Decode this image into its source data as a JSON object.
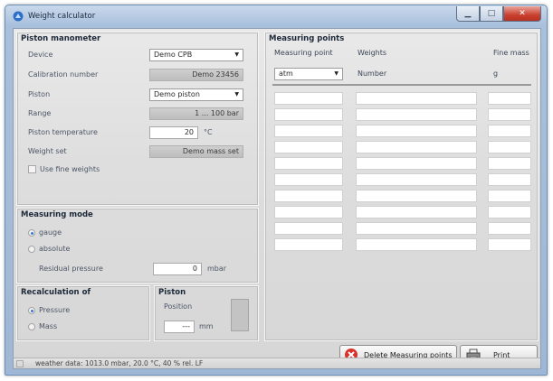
{
  "window": {
    "title": "Weight calculator"
  },
  "piston_manometer": {
    "title": "Piston manometer",
    "device_label": "Device",
    "device_value": "Demo CPB",
    "calibration_label": "Calibration number",
    "calibration_value": "Demo 23456",
    "piston_label": "Piston",
    "piston_value": "Demo piston",
    "range_label": "Range",
    "range_value": "1 ... 100 bar",
    "temp_label": "Piston temperature",
    "temp_value": "20",
    "temp_unit": "°C",
    "weightset_label": "Weight set",
    "weightset_value": "Demo mass set",
    "fine_weights_label": "Use fine weights",
    "fine_weights_checked": false
  },
  "measuring_mode": {
    "title": "Measuring mode",
    "gauge_label": "gauge",
    "absolute_label": "absolute",
    "selected": "gauge",
    "residual_label": "Residual pressure",
    "residual_value": "0",
    "residual_unit": "mbar"
  },
  "recalculation": {
    "title": "Recalculation of",
    "pressure_label": "Pressure",
    "mass_label": "Mass",
    "selected": "Pressure"
  },
  "piston": {
    "title": "Piston",
    "position_label": "Position",
    "position_value": "---",
    "position_unit": "mm"
  },
  "measuring_points": {
    "title": "Measuring points",
    "col_point": "Measuring point",
    "col_weights": "Weights",
    "col_fine": "Fine mass",
    "point_select": "atm",
    "weights_sub": "Number",
    "fine_sub": "g",
    "row_count": 10
  },
  "buttons": {
    "delete_label": "Delete Measuring points",
    "print_label": "Print"
  },
  "status": {
    "weather": "weather data: 1013.0 mbar, 20.0 °C, 40 % rel. LF"
  }
}
